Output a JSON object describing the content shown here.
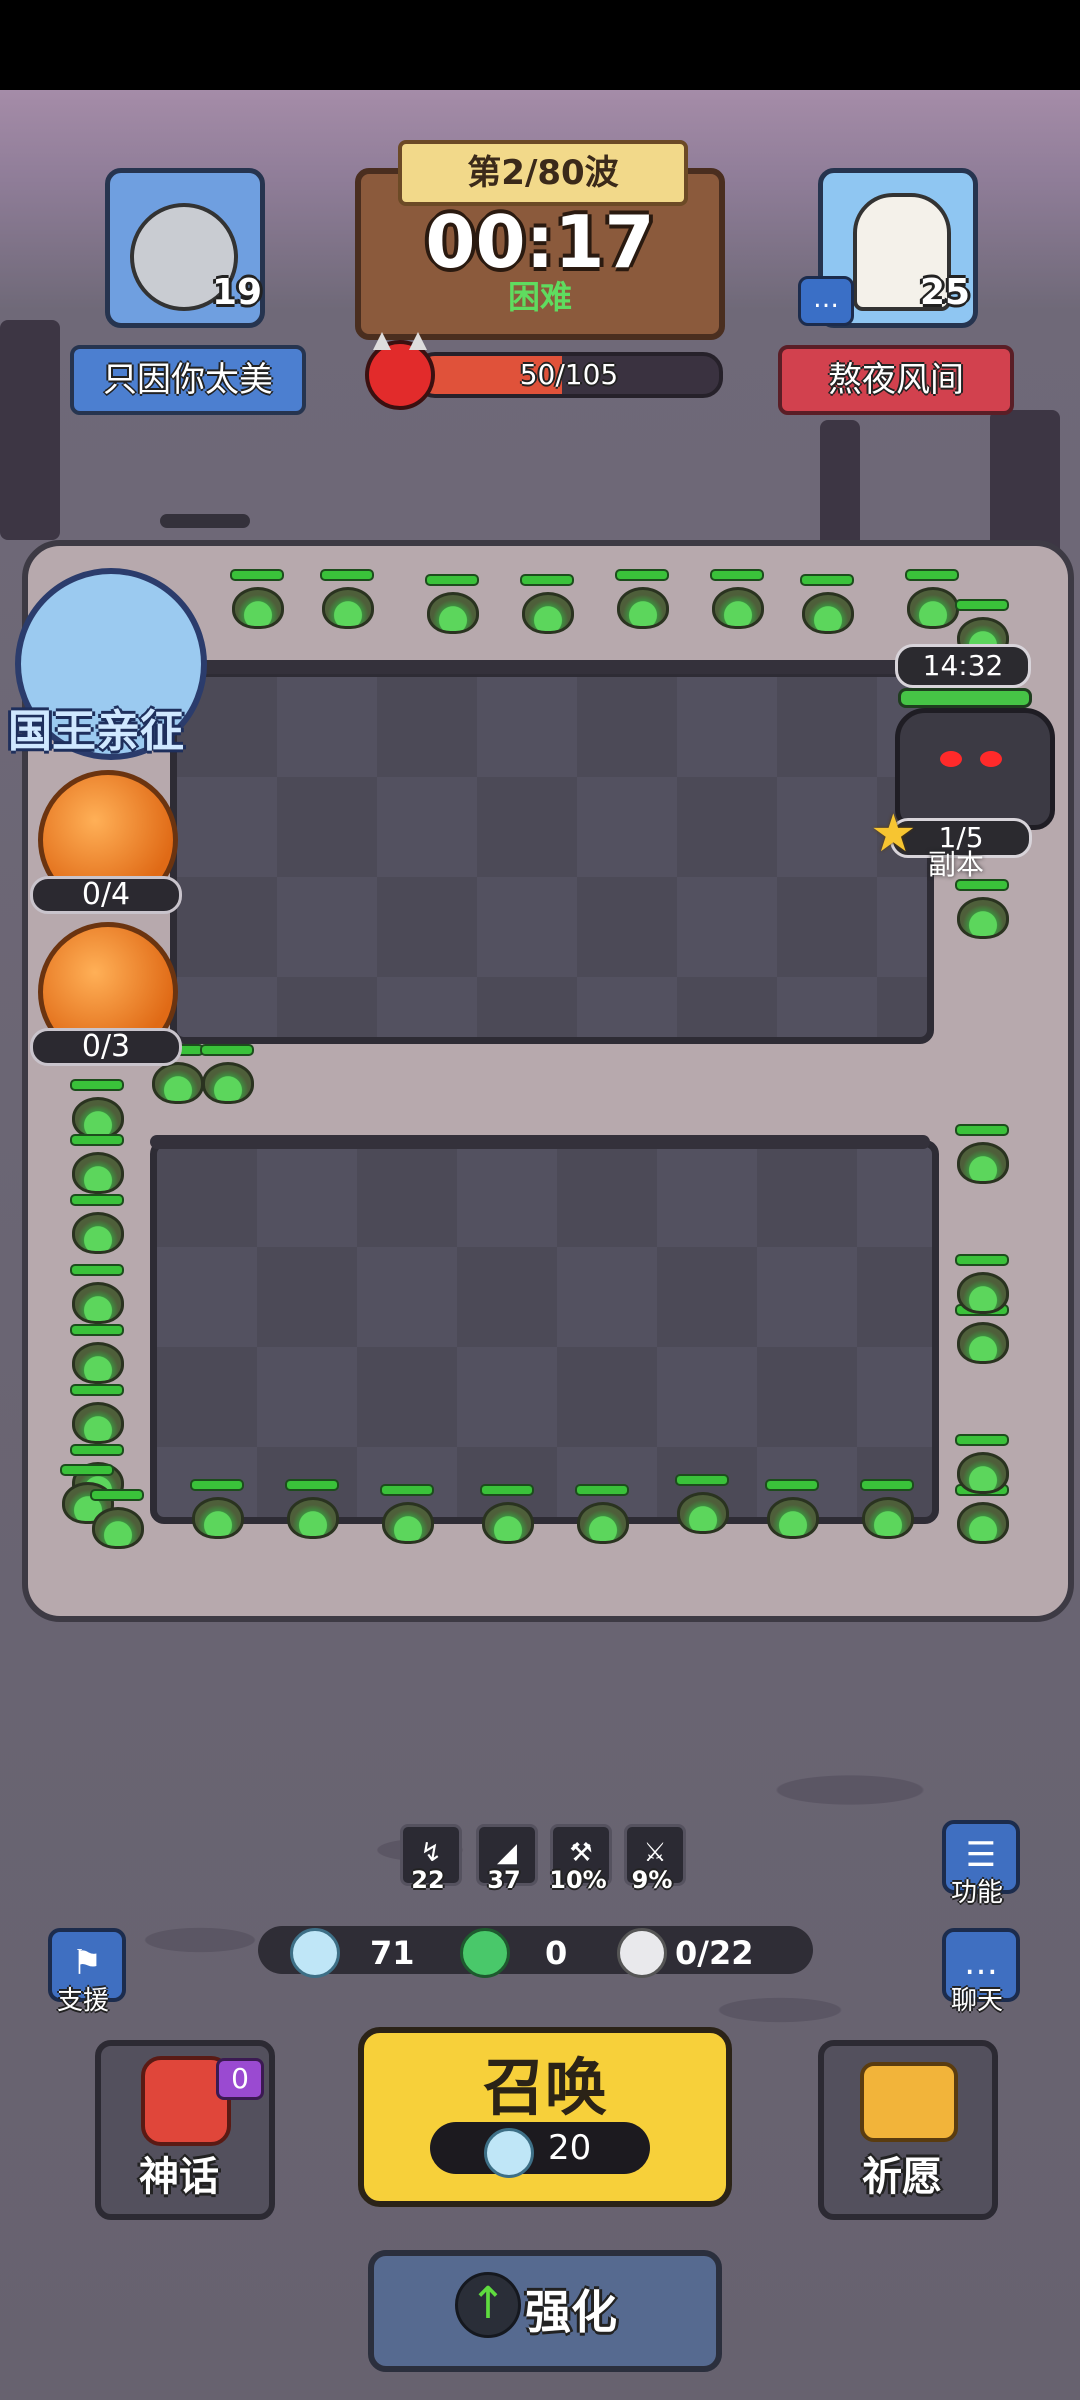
{
  "header": {
    "wave": "第2/80波",
    "timer": "00:17",
    "difficulty": "困难",
    "enemy_progress": "50/105",
    "enemy_progress_fraction": 0.476
  },
  "players": {
    "left": {
      "name": "只因你太美",
      "level": "19"
    },
    "right": {
      "name": "熬夜风间",
      "level": "25"
    }
  },
  "heroes": {
    "king_label": "国王亲征",
    "slot1_count": "0/4",
    "slot2_count": "0/3"
  },
  "boss": {
    "timer": "14:32",
    "stage": "1/5",
    "label": "副本"
  },
  "stats": [
    "22",
    "37",
    "10%",
    "9%"
  ],
  "resources": {
    "crystal": "71",
    "gem": "0",
    "units": "0/22"
  },
  "side_buttons": {
    "support": "支援",
    "functions": "功能",
    "chat": "聊天"
  },
  "bottom": {
    "myth_label": "神话",
    "myth_badge": "0",
    "summon_label": "召唤",
    "summon_cost": "20",
    "wish_label": "祈愿",
    "upgrade_label": "强化"
  },
  "colors": {
    "path": "#b7a9ad",
    "enemy_hp": "#3ac23a",
    "summon": "#f7d03a",
    "danger": "#e0523a"
  }
}
